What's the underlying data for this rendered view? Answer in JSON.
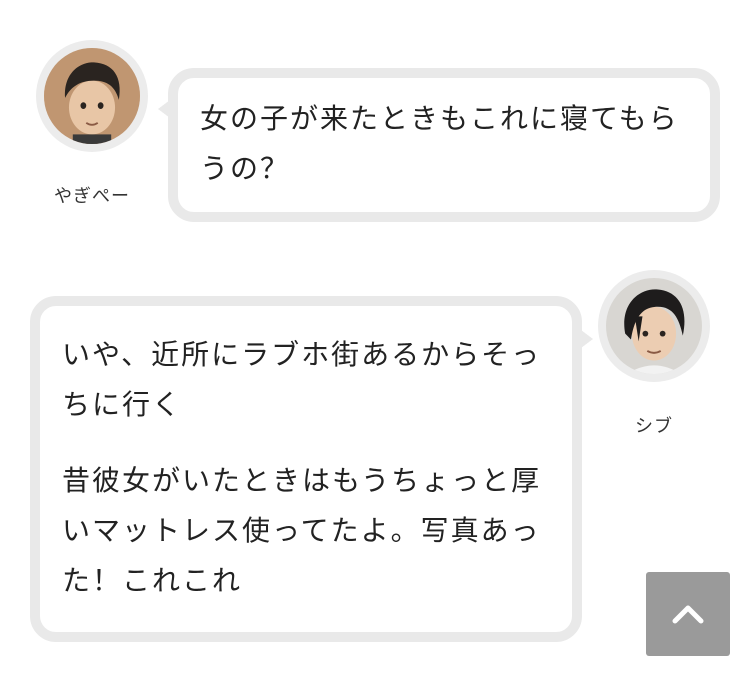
{
  "messages": [
    {
      "speaker": "やぎぺー",
      "side": "left",
      "avatar_icon": "person-avatar-icon",
      "paragraphs": [
        "女の子が来たときもこれに寝てもらうの？"
      ]
    },
    {
      "speaker": "シブ",
      "side": "right",
      "avatar_icon": "person-avatar-icon",
      "paragraphs": [
        "いや、近所にラブホ街あるからそっちに行く",
        "昔彼女がいたときはもうちょっと厚いマットレス使ってたよ。写真あった！これこれ"
      ]
    }
  ],
  "scroll_top_button": {
    "icon": "chevron-up-icon",
    "color": "#9a9a9a"
  },
  "colors": {
    "bubble_border": "#e9e9e9",
    "avatar_ring": "#ececec",
    "text": "#222222"
  }
}
